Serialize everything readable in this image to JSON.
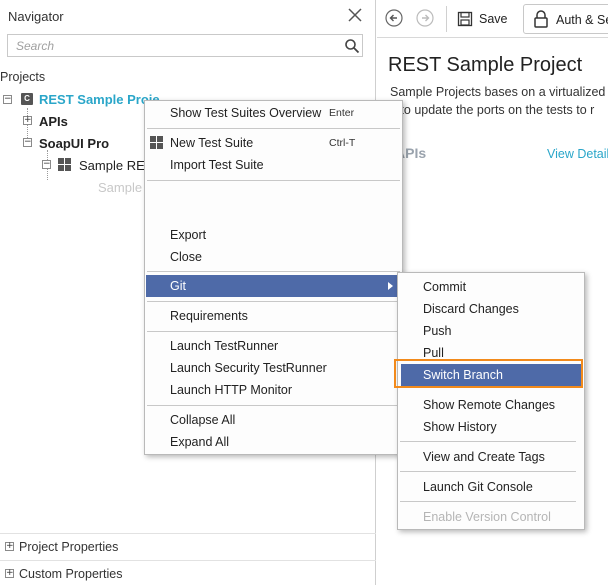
{
  "navigator": {
    "title": "Navigator",
    "search_placeholder": "Search",
    "projects_label": "Projects",
    "tree": {
      "project": "REST Sample Proje",
      "apis": "APIs",
      "soapui_pro": "SoapUI Pro",
      "sample_rest": "Sample RES",
      "faded_child": "Sample"
    },
    "project_properties": "Project Properties",
    "custom_properties": "Custom Properties"
  },
  "editor": {
    "toolbar": {
      "save_label": "Save",
      "auth_label": "Auth & Se"
    },
    "title": "REST Sample Project",
    "description_line1": "Sample Projects bases on a virtualized",
    "description_line2": "e to update the ports on the tests to r",
    "apis_heading": "APIs",
    "view_details": "View Details"
  },
  "context_menu": {
    "items": [
      {
        "label": "Show Test Suites Overview",
        "shortcut": "Enter"
      },
      {
        "label": "New Test Suite",
        "shortcut": "Ctrl-T"
      },
      {
        "label": "Import Test Suite"
      },
      {
        "label": "Export"
      },
      {
        "label": "Close"
      },
      {
        "label": "Git"
      },
      {
        "label": "Requirements"
      },
      {
        "label": "Launch TestRunner"
      },
      {
        "label": "Launch Security TestRunner"
      },
      {
        "label": "Launch HTTP Monitor"
      },
      {
        "label": "Collapse All"
      },
      {
        "label": "Expand All"
      }
    ]
  },
  "git_submenu": {
    "items": [
      {
        "label": "Commit"
      },
      {
        "label": "Discard Changes"
      },
      {
        "label": "Push"
      },
      {
        "label": "Pull"
      },
      {
        "label": "Switch Branch"
      },
      {
        "label": "Show Remote Changes"
      },
      {
        "label": "Show History"
      },
      {
        "label": "View and Create Tags"
      },
      {
        "label": "Launch Git Console"
      },
      {
        "label": "Enable Version Control"
      }
    ]
  },
  "colors": {
    "selection": "#4e6aa8",
    "highlight_outline": "#f28a1b",
    "link": "#2aa6c9"
  },
  "icons": [
    "close-icon",
    "search-icon",
    "back-arrow-icon",
    "forward-arrow-icon",
    "save-icon",
    "lock-icon",
    "grid-icon",
    "project-icon",
    "submenu-arrow-icon"
  ]
}
